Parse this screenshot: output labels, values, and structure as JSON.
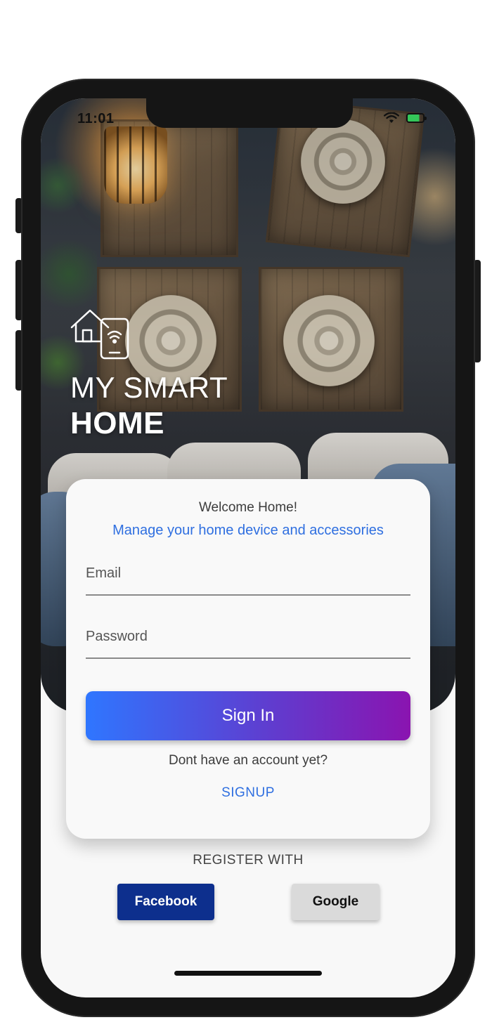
{
  "status_bar": {
    "time": "11:01",
    "icons": [
      "wifi-icon",
      "battery-icon"
    ]
  },
  "brand": {
    "logo_icon": "smart-home-icon",
    "line1": "MY SMART",
    "line2": "HOME"
  },
  "login_card": {
    "welcome": "Welcome Home!",
    "tagline": "Manage your home device and accessories",
    "email_placeholder": "Email",
    "email_value": "",
    "password_placeholder": "Password",
    "password_value": "",
    "signin_label": "Sign In",
    "no_account_text": "Dont have an account yet?",
    "signup_label": "SIGNUP"
  },
  "register": {
    "heading": "REGISTER WITH",
    "facebook_label": "Facebook",
    "google_label": "Google"
  },
  "colors": {
    "accent_blue": "#2f6fe0",
    "gradient_start": "#2f76ff",
    "gradient_end": "#8a14b0",
    "facebook": "#0d2f8d",
    "google": "#dadada"
  }
}
